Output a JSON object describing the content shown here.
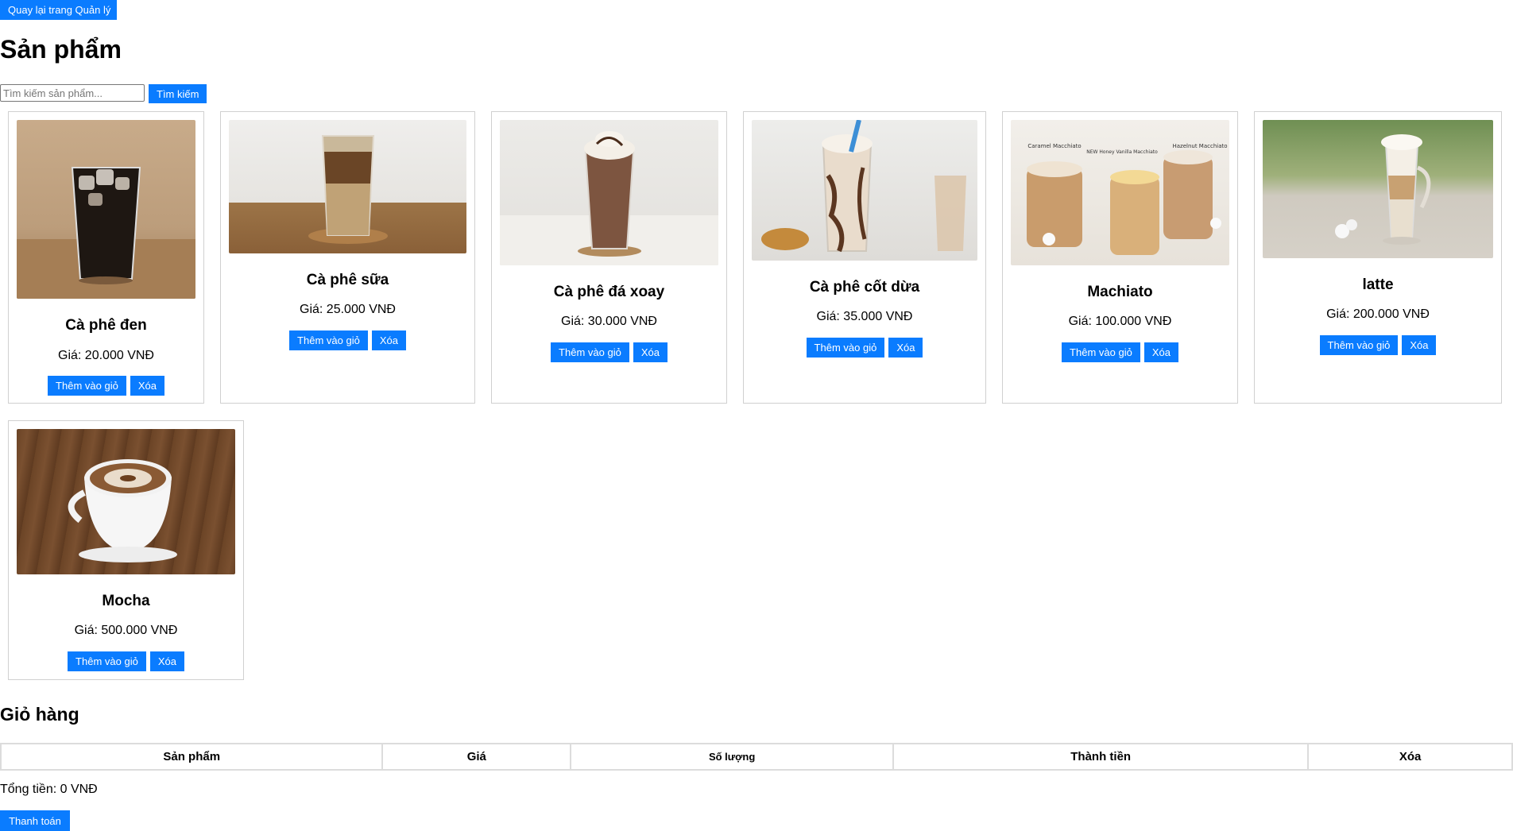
{
  "header": {
    "back_label": "Quay lại trang Quản lý",
    "title": "Sản phẩm"
  },
  "search": {
    "placeholder": "Tìm kiếm sản phẩm...",
    "button_label": "Tìm kiếm"
  },
  "products": [
    {
      "name": "Cà phê đen",
      "price": "Giá: 20.000 VNĐ",
      "add_label": "Thêm vào giỏ",
      "delete_label": "Xóa"
    },
    {
      "name": "Cà phê sữa",
      "price": "Giá: 25.000 VNĐ",
      "add_label": "Thêm vào giỏ",
      "delete_label": "Xóa"
    },
    {
      "name": "Cà phê đá xoay",
      "price": "Giá: 30.000 VNĐ",
      "add_label": "Thêm vào giỏ",
      "delete_label": "Xóa"
    },
    {
      "name": "Cà phê cốt dừa",
      "price": "Giá: 35.000 VNĐ",
      "add_label": "Thêm vào giỏ",
      "delete_label": "Xóa"
    },
    {
      "name": "Machiato",
      "price": "Giá: 100.000 VNĐ",
      "add_label": "Thêm vào giỏ",
      "delete_label": "Xóa"
    },
    {
      "name": "latte",
      "price": "Giá: 200.000 VNĐ",
      "add_label": "Thêm vào giỏ",
      "delete_label": "Xóa"
    },
    {
      "name": "Mocha",
      "price": "Giá: 500.000 VNĐ",
      "add_label": "Thêm vào giỏ",
      "delete_label": "Xóa"
    }
  ],
  "photo_labels": {
    "caramel": "Caramel Macchiato",
    "honey": "NEW Honey Vanilla Macchiato",
    "hazelnut": "Hazelnut Macchiato"
  },
  "cart": {
    "title": "Giỏ hàng",
    "columns": [
      "Sản phẩm",
      "Giá",
      "Số lượng",
      "Thành tiền",
      "Xóa"
    ],
    "total": "Tổng tiền: 0 VNĐ",
    "checkout_label": "Thanh toán"
  },
  "colors": {
    "accent": "#0a7cff",
    "border": "#d0d0d0"
  }
}
